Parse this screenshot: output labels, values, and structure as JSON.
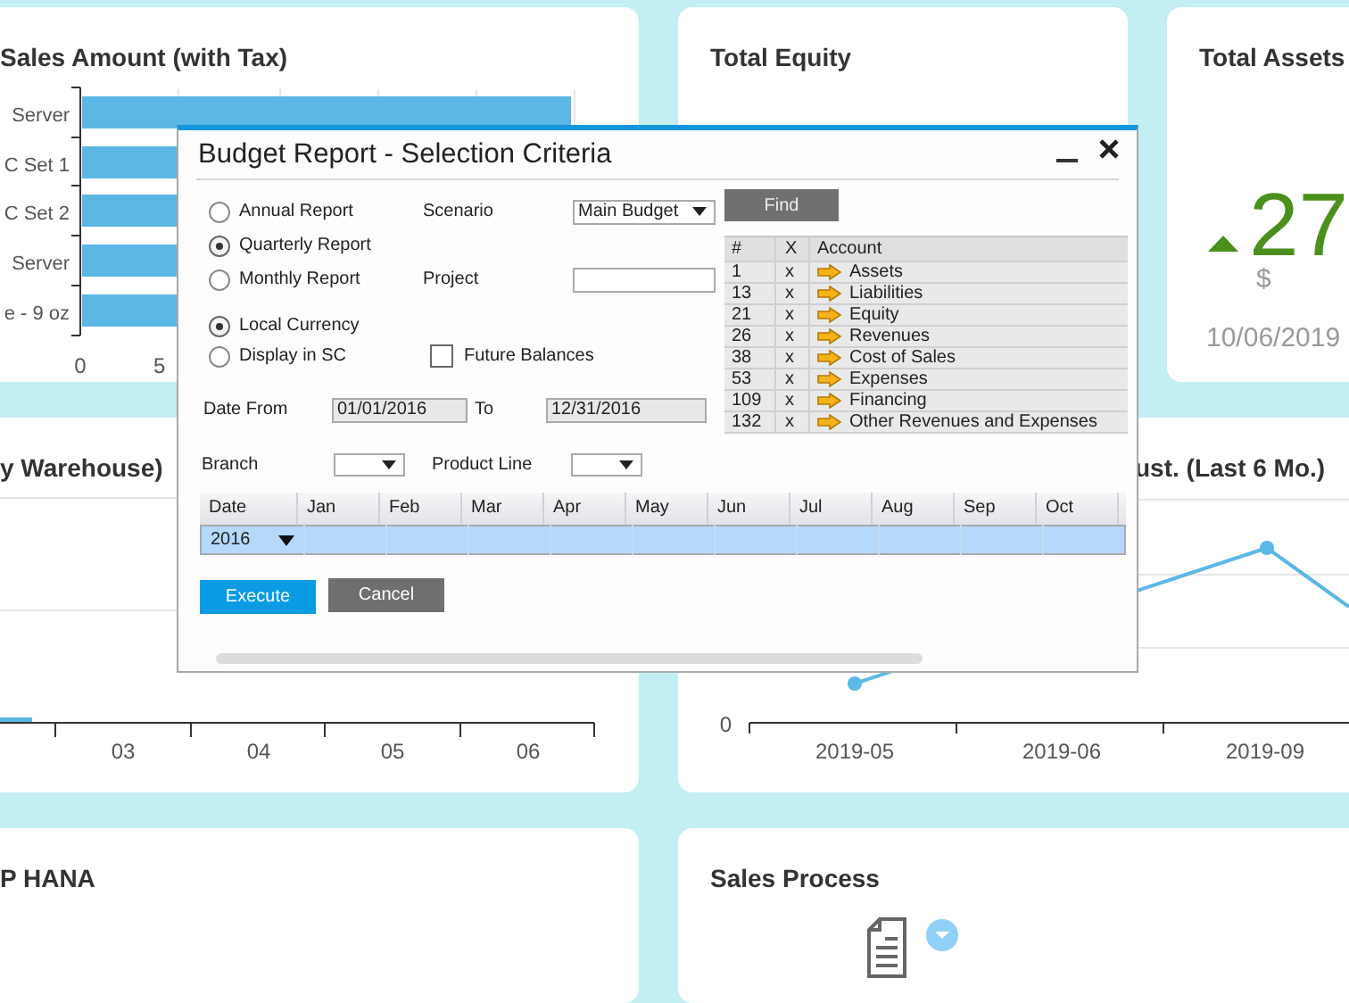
{
  "dashboard": {
    "sales_card": {
      "title": "Sales Amount (with Tax)",
      "bar_labels": [
        "Server",
        "C Set 1",
        "C Set 2",
        "Server",
        "e - 9 oz"
      ],
      "axis_labels": [
        "0",
        "5"
      ]
    },
    "equity_card": {
      "title": "Total Equity"
    },
    "assets_card": {
      "title": "Total Assets",
      "rising": true,
      "value": "27",
      "currency": "$",
      "date": "10/06/2019"
    },
    "warehouse_card": {
      "title": "y Warehouse)",
      "axis_labels": [
        "03",
        "04",
        "05",
        "06"
      ]
    },
    "forecast_card": {
      "title": "ust. (Last 6 Mo.)",
      "y_label": "0",
      "x_labels": [
        "2019-05",
        "2019-06",
        "2019-09"
      ]
    },
    "hana_card": {
      "title": "P HANA"
    },
    "process_card": {
      "title": "Sales Process"
    }
  },
  "dialog": {
    "title": "Budget Report - Selection Criteria",
    "report_types": [
      {
        "label": "Annual Report",
        "selected": false
      },
      {
        "label": "Quarterly Report",
        "selected": true
      },
      {
        "label": "Monthly Report",
        "selected": false
      }
    ],
    "scenario": {
      "label": "Scenario",
      "value": "Main Budget"
    },
    "project": {
      "label": "Project"
    },
    "currency_options": [
      {
        "label": "Local Currency",
        "selected": true
      },
      {
        "label": "Display in SC",
        "selected": false
      }
    ],
    "future_balances": {
      "label": "Future Balances",
      "checked": false
    },
    "date_from": {
      "label": "Date From",
      "value": "01/01/2016"
    },
    "date_to": {
      "label": "To",
      "value": "12/31/2016"
    },
    "branch": {
      "label": "Branch"
    },
    "product_line": {
      "label": "Product Line"
    },
    "period_grid": {
      "columns": [
        "Date",
        "Jan",
        "Feb",
        "Mar",
        "Apr",
        "May",
        "Jun",
        "Jul",
        "Aug",
        "Sep",
        "Oct"
      ],
      "row": {
        "year": "2016",
        "selected": true
      }
    },
    "buttons": [
      {
        "label": "Execute",
        "kind": "primary"
      },
      {
        "label": "Cancel",
        "kind": "secondary"
      }
    ],
    "find_button": "Find",
    "accounts": {
      "columns": [
        "#",
        "X",
        "Account"
      ],
      "rows": [
        {
          "number": "1",
          "mark": "x",
          "name": "Assets"
        },
        {
          "number": "13",
          "mark": "x",
          "name": "Liabilities"
        },
        {
          "number": "21",
          "mark": "x",
          "name": "Equity"
        },
        {
          "number": "26",
          "mark": "x",
          "name": "Revenues"
        },
        {
          "number": "38",
          "mark": "x",
          "name": "Cost of Sales"
        },
        {
          "number": "53",
          "mark": "x",
          "name": "Expenses"
        },
        {
          "number": "109",
          "mark": "x",
          "name": "Financing"
        },
        {
          "number": "132",
          "mark": "x",
          "name": "Other Revenues and Expenses"
        }
      ]
    }
  }
}
